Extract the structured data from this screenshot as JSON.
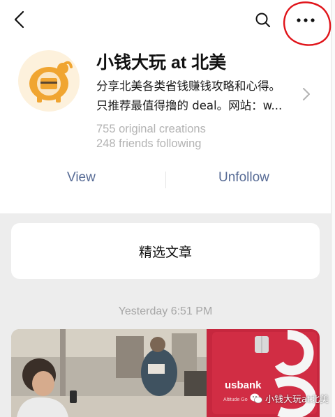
{
  "account": {
    "name": "小钱大玩 at 北美",
    "description_line1": "分享北美各类省钱赚钱攻略和心得。",
    "description_line2": "只推荐最值得撸的 deal。网站：w...",
    "stats_creations": "755 original creations",
    "stats_friends": "248 friends following"
  },
  "actions": {
    "view": "View",
    "unfollow": "Unfollow"
  },
  "section_title": "精选文章",
  "timestamp": "Yesterday 6:51 PM",
  "article": {
    "bank_brand": "usbank",
    "card_name": "Altitude Go"
  },
  "watermark": "小钱大玩at北美",
  "icons": [
    "back-arrow-icon",
    "search-icon",
    "more-icon",
    "piggy-bank-icon",
    "chevron-right-icon",
    "wechat-icon"
  ],
  "colors": {
    "link": "#576b95",
    "annotation": "#e0141a",
    "avatar": "#f0a531"
  }
}
